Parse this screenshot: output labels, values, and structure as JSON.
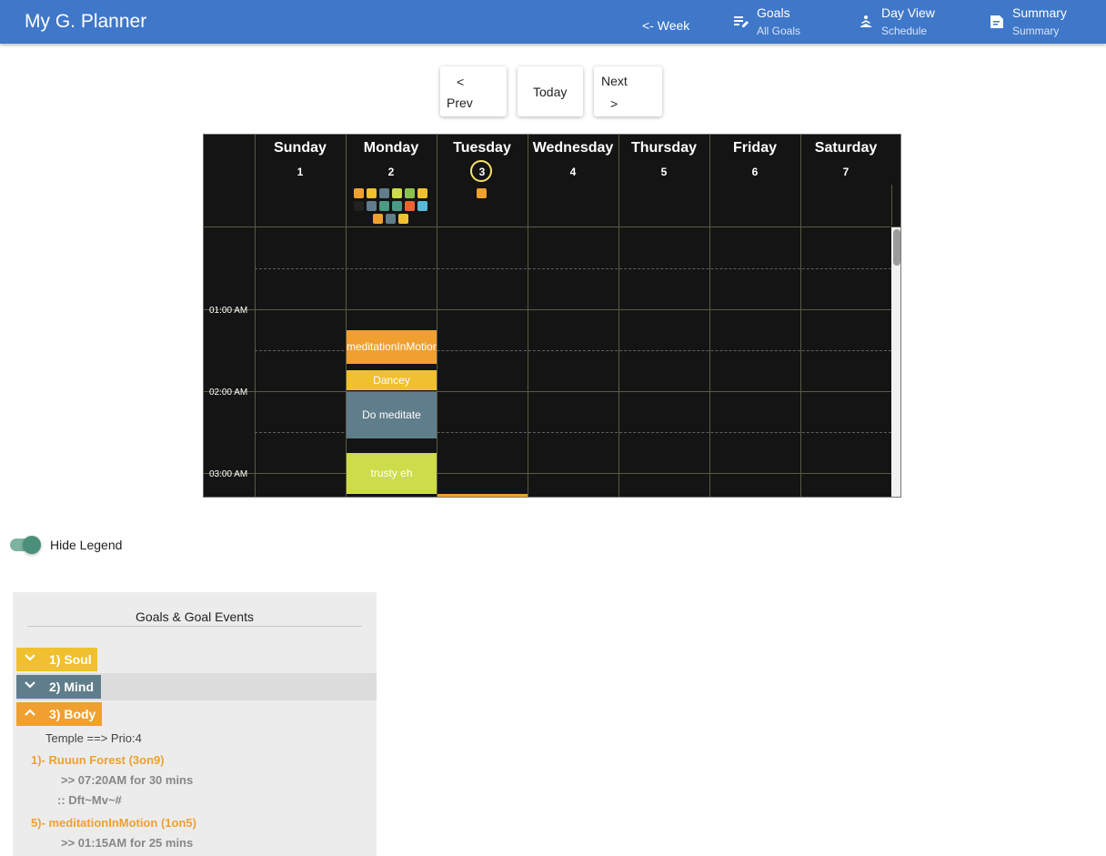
{
  "app": {
    "title": "My G. Planner"
  },
  "nav": {
    "week_link": "<- Week",
    "items": [
      {
        "label": "Goals",
        "sublabel": "All Goals",
        "icon": "edit-list-icon"
      },
      {
        "label": "Day View",
        "sublabel": "Schedule",
        "icon": "meditation-icon"
      },
      {
        "label": "Summary",
        "sublabel": "Summary",
        "icon": "note-icon"
      }
    ]
  },
  "pager": {
    "prev_arrow": "<",
    "prev_label": "Prev",
    "today_label": "Today",
    "next_label": "Next",
    "next_arrow": ">"
  },
  "calendar": {
    "days": [
      {
        "name": "Sunday",
        "num": "1"
      },
      {
        "name": "Monday",
        "num": "2"
      },
      {
        "name": "Tuesday",
        "num": "3",
        "today": true
      },
      {
        "name": "Wednesday",
        "num": "4"
      },
      {
        "name": "Thursday",
        "num": "5"
      },
      {
        "name": "Friday",
        "num": "6"
      },
      {
        "name": "Saturday",
        "num": "7"
      }
    ],
    "time_labels": [
      "01:00 AM",
      "02:00 AM",
      "03:00 AM"
    ],
    "monday_dots": [
      "#f0a030",
      "#f0c030",
      "#607d8b",
      "#cddc4a",
      "#8bc34a",
      "#f0c030",
      "#222222",
      "#607d8b",
      "#4a9a86",
      "#4a9a86",
      "#f06030",
      "#58b8d8",
      "#f0a030",
      "#607d8b",
      "#f0c030"
    ],
    "tuesday_dots": [
      "#f0a030"
    ],
    "events": [
      {
        "title": "meditationInMotion",
        "color": "#f0a030"
      },
      {
        "title": "Dancey",
        "color": "#f0c030"
      },
      {
        "title": "Do meditate",
        "color": "#607d8b"
      },
      {
        "title": "trusty eh",
        "color": "#cddc4a"
      }
    ]
  },
  "legend_toggle": {
    "label": "Hide Legend",
    "on": true
  },
  "legend": {
    "title": "Goals & Goal Events",
    "groups": [
      {
        "label": "1) Soul",
        "color": "#f0c030",
        "expanded": false
      },
      {
        "label": "2) Mind",
        "color": "#607d8b",
        "expanded": false
      },
      {
        "label": "3) Body",
        "color": "#f0a030",
        "expanded": true
      }
    ],
    "body_subtitle": "Temple ==> Prio:4",
    "goals": [
      {
        "title": "1)- Ruuun Forest (3on9)",
        "time": ">> 07:20AM for 30 mins",
        "code": ":: Dft~Mv~#"
      },
      {
        "title": "5)- meditationInMotion (1on5)",
        "time": ">> 01:15AM for 25 mins"
      }
    ],
    "goal_color": "#f0a030"
  }
}
